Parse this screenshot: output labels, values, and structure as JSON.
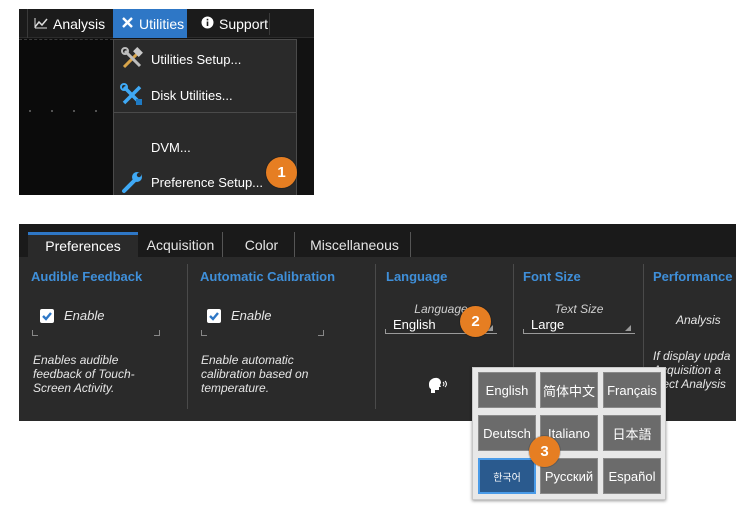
{
  "top_menu": {
    "analysis": "Analysis",
    "utilities": "Utilities",
    "support": "Support"
  },
  "utilities_menu": {
    "items": [
      {
        "label": "Utilities Setup...",
        "icon": "tools-icon"
      },
      {
        "label": "Disk Utilities...",
        "icon": "disk-tools-icon"
      },
      {
        "label": "DVM...",
        "icon": ""
      },
      {
        "label": "Preference Setup...",
        "icon": "wrench-icon"
      }
    ]
  },
  "callouts": {
    "one": "1",
    "two": "2",
    "three": "3"
  },
  "tabs": [
    "Preferences",
    "Acquisition",
    "Color",
    "Miscellaneous"
  ],
  "sections": {
    "audible": {
      "title": "Audible Feedback",
      "checkbox_label": "Enable",
      "checked": true,
      "description": "Enables audible feedback of Touch-Screen Activity."
    },
    "calibration": {
      "title": "Automatic Calibration",
      "checkbox_label": "Enable",
      "checked": true,
      "description": "Enable automatic calibration based on temperature."
    },
    "language": {
      "title": "Language",
      "caption": "Language",
      "value": "English"
    },
    "font_size": {
      "title": "Font Size",
      "caption": "Text Size",
      "value": "Large"
    },
    "performance": {
      "title": "Performance",
      "option": "Analysis",
      "description_lines": [
        "If display upda",
        "Acquisition a",
        "elect Analysis"
      ]
    }
  },
  "languages": [
    [
      "English",
      "简体中文",
      "Français"
    ],
    [
      "Deutsch",
      "Italiano",
      "日本語"
    ],
    [
      "한국어",
      "Русский",
      "Español"
    ]
  ],
  "selected_language": "한국어",
  "colors": {
    "accent": "#2e77c6",
    "section_title": "#3f8fd9",
    "callout": "#e67e22",
    "panel_bg": "#2a2a2a"
  }
}
